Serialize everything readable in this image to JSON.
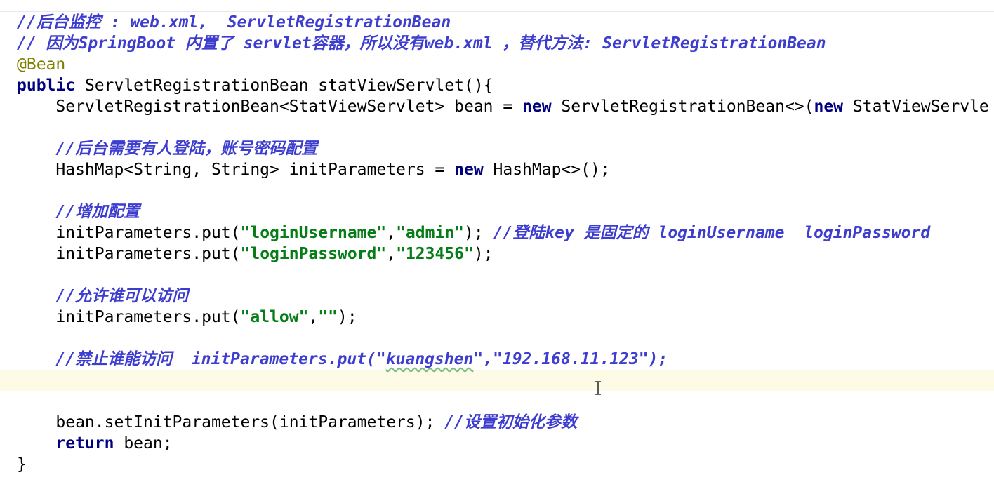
{
  "editor": {
    "language": "Java",
    "caret_line_index": 17,
    "lines": [
      {
        "tokens": [
          {
            "t": "comment",
            "text": "//后台监控 : web.xml,  ServletRegistrationBean"
          }
        ]
      },
      {
        "tokens": [
          {
            "t": "comment",
            "text": "// 因为SpringBoot 内置了 servlet容器，所以没有web.xml ，替代方法: ServletRegistrationBean"
          }
        ]
      },
      {
        "tokens": [
          {
            "t": "annot",
            "text": "@Bean"
          }
        ]
      },
      {
        "tokens": [
          {
            "t": "keyword",
            "text": "public"
          },
          {
            "t": "plain",
            "text": " ServletRegistrationBean statViewServlet(){"
          }
        ]
      },
      {
        "tokens": [
          {
            "t": "plain",
            "text": "    ServletRegistrationBean<StatViewServlet> bean = "
          },
          {
            "t": "keyword",
            "text": "new"
          },
          {
            "t": "plain",
            "text": " ServletRegistrationBean<>("
          },
          {
            "t": "keyword",
            "text": "new"
          },
          {
            "t": "plain",
            "text": " StatViewServle"
          }
        ]
      },
      {
        "tokens": []
      },
      {
        "tokens": [
          {
            "t": "plain",
            "text": "    "
          },
          {
            "t": "comment",
            "text": "//后台需要有人登陆，账号密码配置"
          }
        ]
      },
      {
        "tokens": [
          {
            "t": "plain",
            "text": "    HashMap<String, String> initParameters = "
          },
          {
            "t": "keyword",
            "text": "new"
          },
          {
            "t": "plain",
            "text": " HashMap<>();"
          }
        ]
      },
      {
        "tokens": []
      },
      {
        "tokens": [
          {
            "t": "plain",
            "text": "    "
          },
          {
            "t": "comment",
            "text": "//增加配置"
          }
        ]
      },
      {
        "tokens": [
          {
            "t": "plain",
            "text": "    initParameters.put("
          },
          {
            "t": "string",
            "text": "\"loginUsername\""
          },
          {
            "t": "plain",
            "text": ","
          },
          {
            "t": "string",
            "text": "\"admin\""
          },
          {
            "t": "plain",
            "text": "); "
          },
          {
            "t": "comment",
            "text": "//登陆key 是固定的 loginUsername  loginPassword"
          }
        ]
      },
      {
        "tokens": [
          {
            "t": "plain",
            "text": "    initParameters.put("
          },
          {
            "t": "string",
            "text": "\"loginPassword\""
          },
          {
            "t": "plain",
            "text": ","
          },
          {
            "t": "string",
            "text": "\"123456\""
          },
          {
            "t": "plain",
            "text": ");"
          }
        ]
      },
      {
        "tokens": []
      },
      {
        "tokens": [
          {
            "t": "plain",
            "text": "    "
          },
          {
            "t": "comment",
            "text": "//允许谁可以访问"
          }
        ]
      },
      {
        "tokens": [
          {
            "t": "plain",
            "text": "    initParameters.put("
          },
          {
            "t": "string",
            "text": "\"allow\""
          },
          {
            "t": "plain",
            "text": ","
          },
          {
            "t": "string",
            "text": "\"\""
          },
          {
            "t": "plain",
            "text": ");"
          }
        ]
      },
      {
        "tokens": []
      },
      {
        "tokens": [
          {
            "t": "plain",
            "text": "    "
          },
          {
            "t": "comment",
            "text": "//禁止谁能访问  initParameters.put(\""
          },
          {
            "t": "comment",
            "text": "kuangshen",
            "typo": true
          },
          {
            "t": "comment",
            "text": "\",\"192.168.11.123\");"
          }
        ]
      },
      {
        "tokens": []
      },
      {
        "tokens": []
      },
      {
        "tokens": [
          {
            "t": "plain",
            "text": "    bean.setInitParameters(initParameters); "
          },
          {
            "t": "comment",
            "text": "//设置初始化参数"
          }
        ]
      },
      {
        "tokens": [
          {
            "t": "plain",
            "text": "    "
          },
          {
            "t": "keyword",
            "text": "return"
          },
          {
            "t": "plain",
            "text": " bean;"
          }
        ]
      },
      {
        "tokens": [
          {
            "t": "plain",
            "text": "}"
          }
        ]
      }
    ]
  },
  "colors": {
    "background": "#ffffff",
    "comment": "#3d3dcf",
    "keyword": "#000080",
    "annotation": "#808000",
    "string": "#067d17",
    "caret_line": "#fdfbe6"
  },
  "icons": {
    "mouse_cursor": "text-cursor-icon"
  }
}
